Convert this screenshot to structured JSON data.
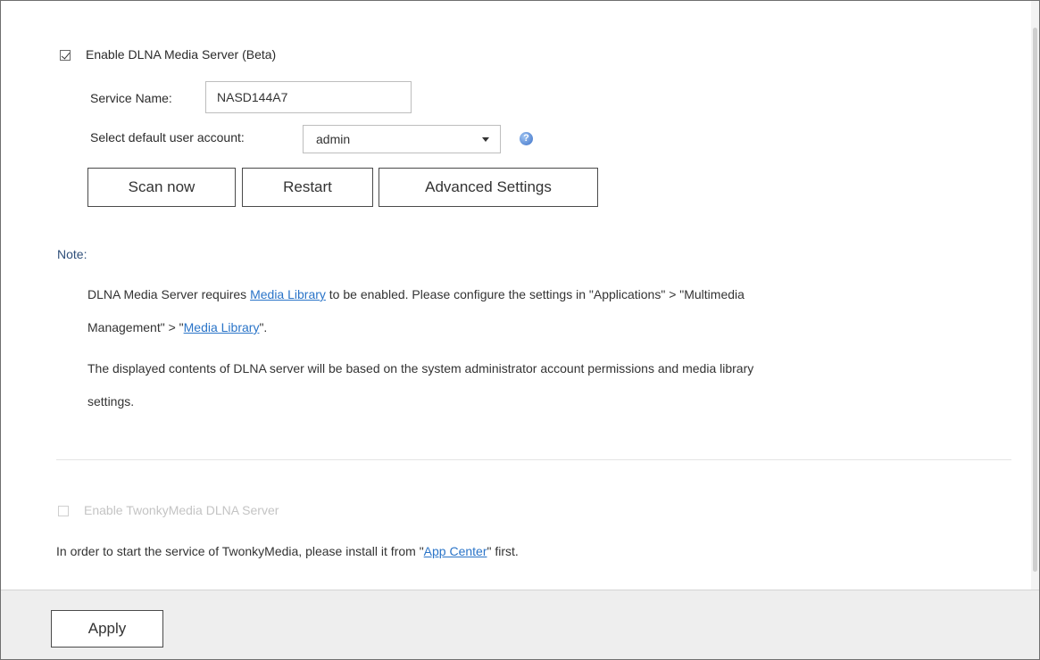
{
  "dlna": {
    "enable_label": "Enable DLNA Media Server (Beta)",
    "enabled": true,
    "service_name_label": "Service Name:",
    "service_name_value": "NASD144A7",
    "user_account_label": "Select default user account:",
    "user_account_value": "admin",
    "help_icon": "help-icon"
  },
  "buttons": {
    "scan_now": "Scan now",
    "restart": "Restart",
    "advanced_settings": "Advanced Settings",
    "apply": "Apply"
  },
  "note": {
    "title": "Note:",
    "line1_a": "DLNA Media Server requires ",
    "line1_link": "Media Library",
    "line1_b": " to be enabled. Please configure the settings in \"Applications\" > \"Multimedia",
    "line2_a": "Management\" > \"",
    "line2_link": "Media Library",
    "line2_b": "\".",
    "line3": "The displayed contents of DLNA server will be based on the system administrator account permissions and media library",
    "line4": "settings."
  },
  "twonky": {
    "enable_label": "Enable TwonkyMedia DLNA Server",
    "enabled": false,
    "info_a": "In order to start the service of TwonkyMedia, please install it from \"",
    "info_link": "App Center",
    "info_b": "\" first."
  },
  "colors": {
    "link": "#2a74c8",
    "note_title": "#2f4f7a",
    "footer_bg": "#eeeeee"
  }
}
